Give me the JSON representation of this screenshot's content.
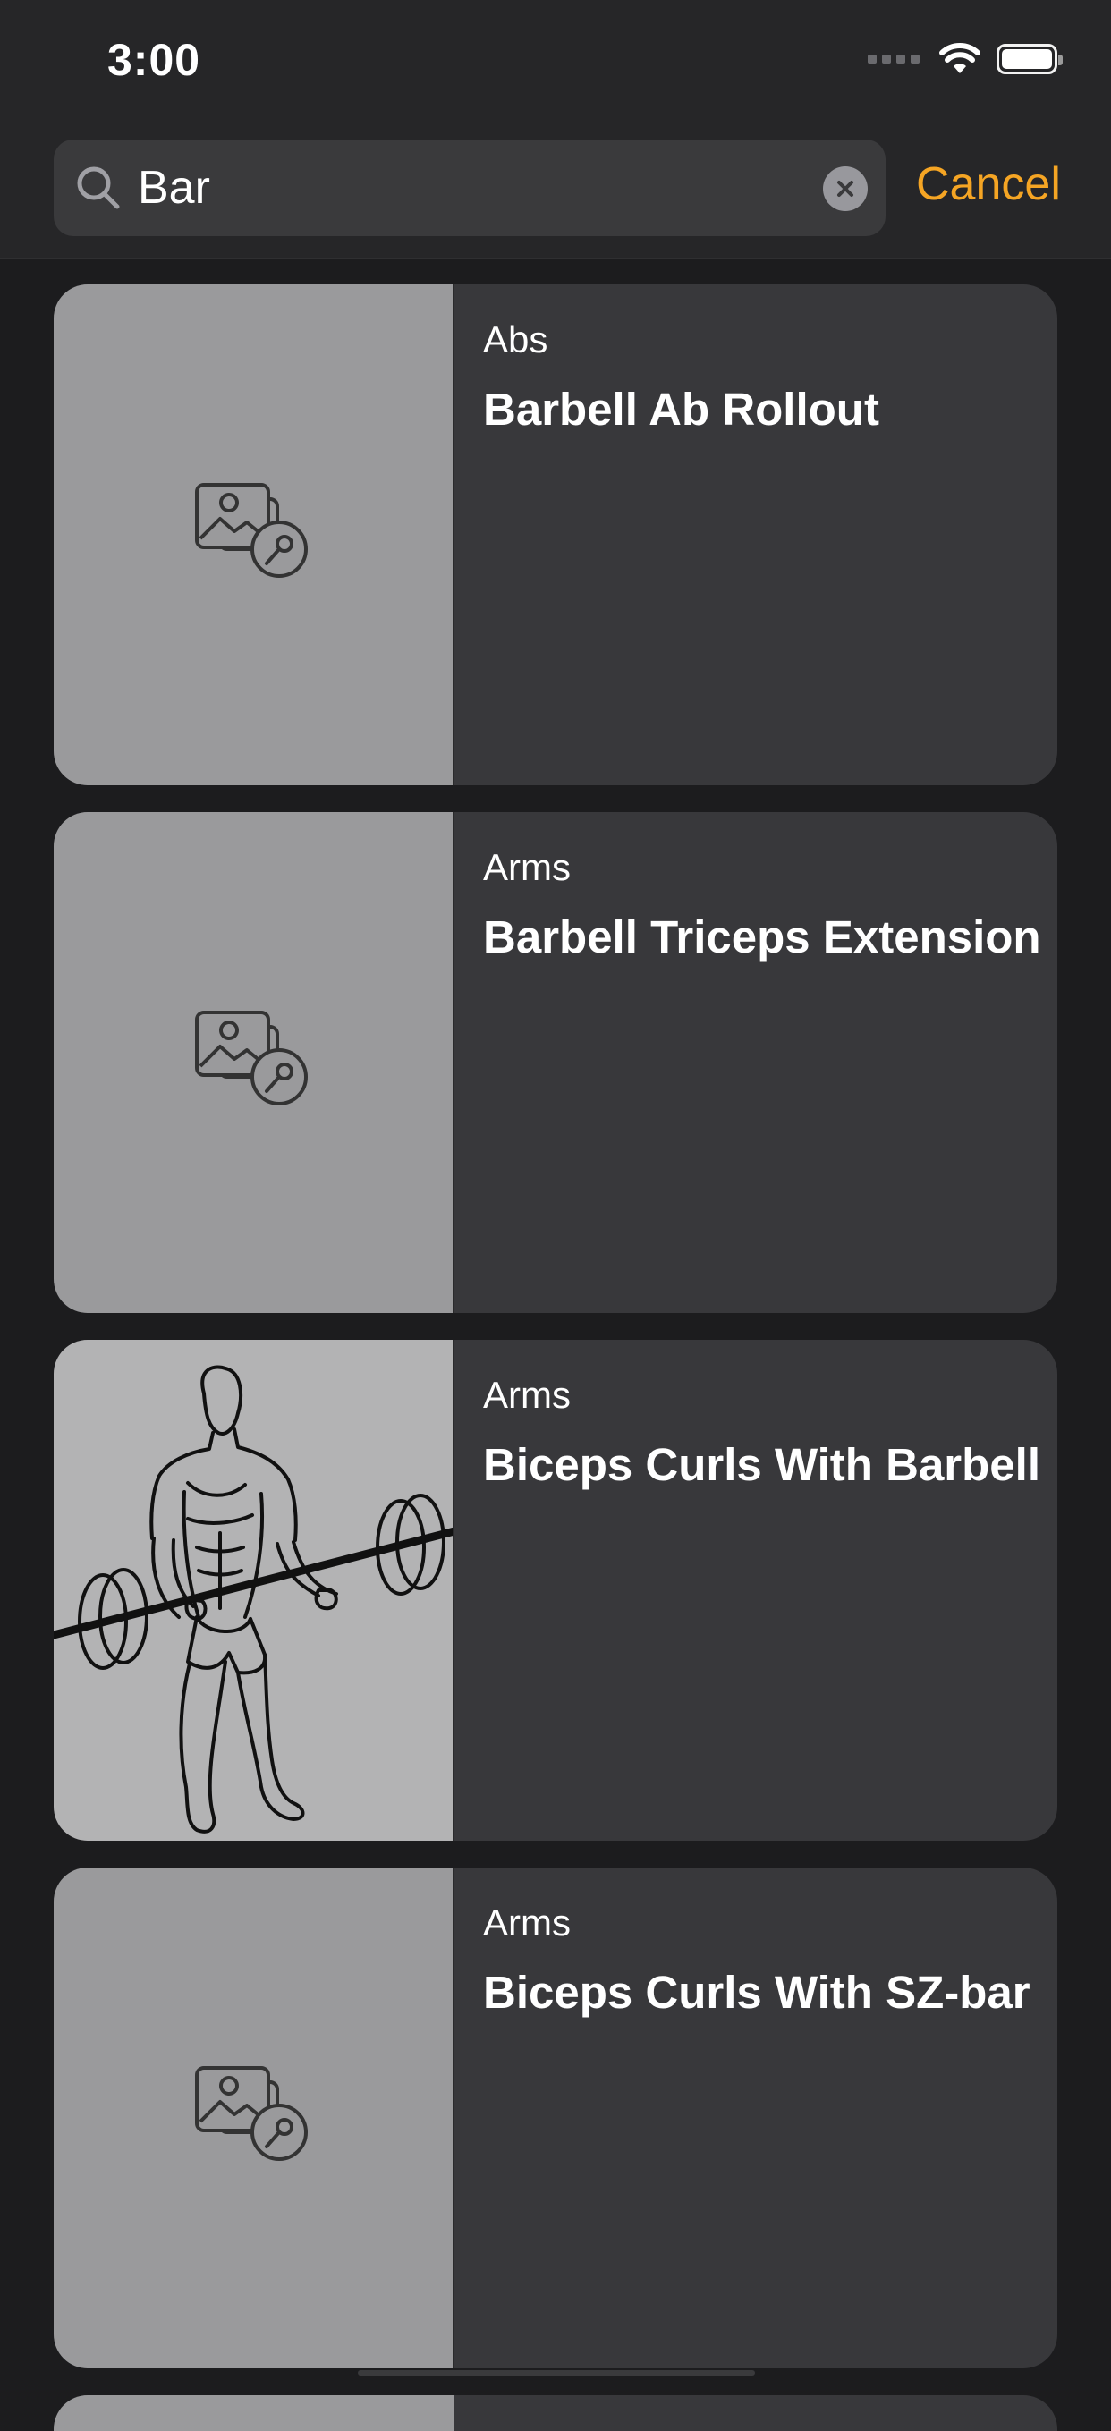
{
  "status_bar": {
    "time": "3:00"
  },
  "search": {
    "value": "Bar",
    "cancel_label": "Cancel"
  },
  "colors": {
    "accent": "#f5a524",
    "background": "#1c1c1e",
    "card": "#38383b"
  },
  "results": [
    {
      "category": "Abs",
      "title": "Barbell Ab Rollout",
      "image": "image-placeholder-icon"
    },
    {
      "category": "Arms",
      "title": "Barbell Triceps Extension",
      "image": "image-placeholder-icon"
    },
    {
      "category": "Arms",
      "title": "Biceps Curls With Barbell",
      "image": "biceps-curl-illustration"
    },
    {
      "category": "Arms",
      "title": "Biceps Curls With SZ-bar",
      "image": "image-placeholder-icon"
    }
  ]
}
